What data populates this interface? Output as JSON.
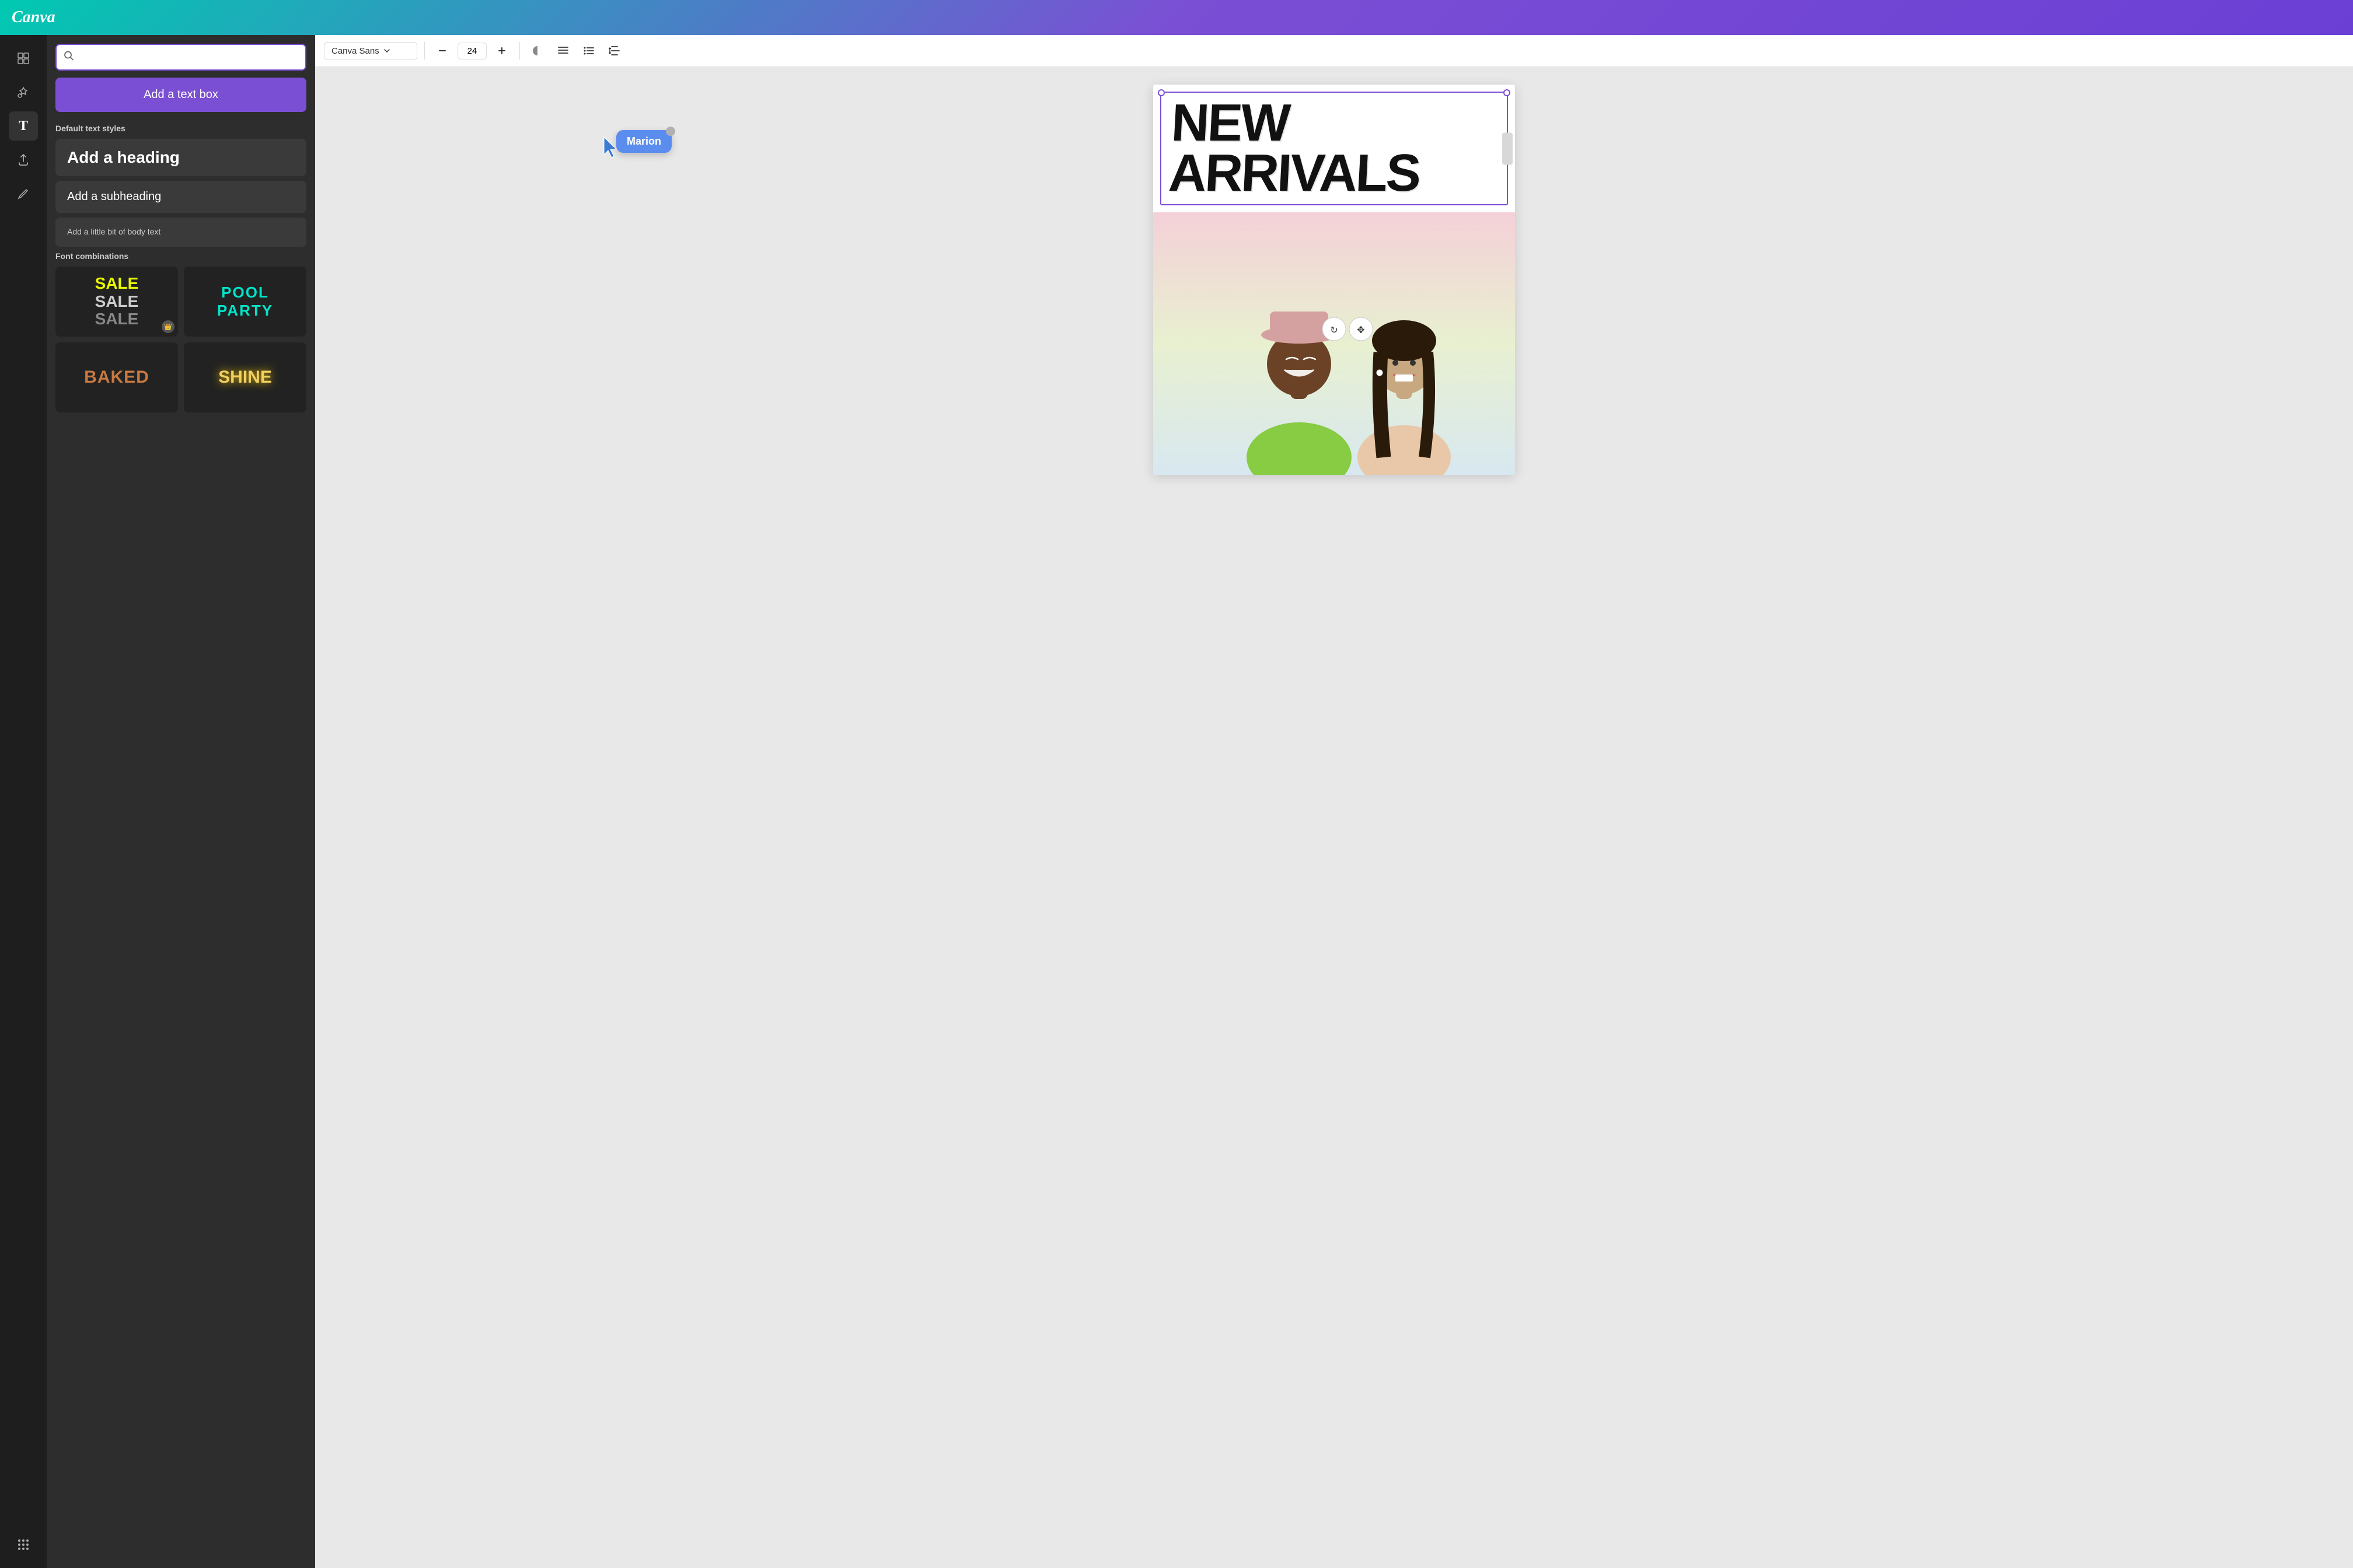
{
  "app": {
    "name": "Canva"
  },
  "header": {
    "logo": "Canva"
  },
  "left_sidebar": {
    "icons": [
      {
        "name": "grid-icon",
        "symbol": "⊞",
        "active": false
      },
      {
        "name": "elements-icon",
        "symbol": "❤△",
        "active": false
      },
      {
        "name": "text-icon",
        "symbol": "T",
        "active": true
      },
      {
        "name": "upload-icon",
        "symbol": "↑",
        "active": false
      },
      {
        "name": "draw-icon",
        "symbol": "✏",
        "active": false
      },
      {
        "name": "apps-icon",
        "symbol": "⋯",
        "active": false
      }
    ]
  },
  "text_panel": {
    "search": {
      "placeholder": ""
    },
    "add_text_box_label": "Add a text box",
    "default_styles_label": "Default text styles",
    "styles": [
      {
        "key": "heading",
        "text": "Add a heading",
        "size": "heading"
      },
      {
        "key": "subheading",
        "text": "Add a subheading",
        "size": "subheading"
      },
      {
        "key": "body",
        "text": "Add a little bit of body text",
        "size": "body"
      }
    ],
    "font_combinations_label": "Font combinations",
    "combinations": [
      {
        "key": "sale",
        "lines": [
          "SALE",
          "SALE",
          "SALE"
        ],
        "colors": [
          "#e8f700",
          "#aaaaaa",
          "#666666"
        ],
        "premium": true
      },
      {
        "key": "pool-party",
        "lines": [
          "POOL",
          "PARTY"
        ],
        "color": "#00e5c8",
        "premium": false
      },
      {
        "key": "baked",
        "text": "BAKED",
        "color": "#c87941",
        "premium": false
      },
      {
        "key": "shine",
        "text": "SHINE",
        "color": "#f0d060",
        "premium": false
      }
    ]
  },
  "toolbar": {
    "font_name": "Canva Sans",
    "font_size": "24",
    "dropdown_arrow": "▾",
    "minus": "−",
    "plus": "+",
    "style_icon": "◑",
    "align_icon": "≡",
    "list_icon": "≣",
    "spacing_icon": "↕"
  },
  "canvas": {
    "selected_text": "NEW\nARRIVALS",
    "tooltip_name": "Marion"
  }
}
